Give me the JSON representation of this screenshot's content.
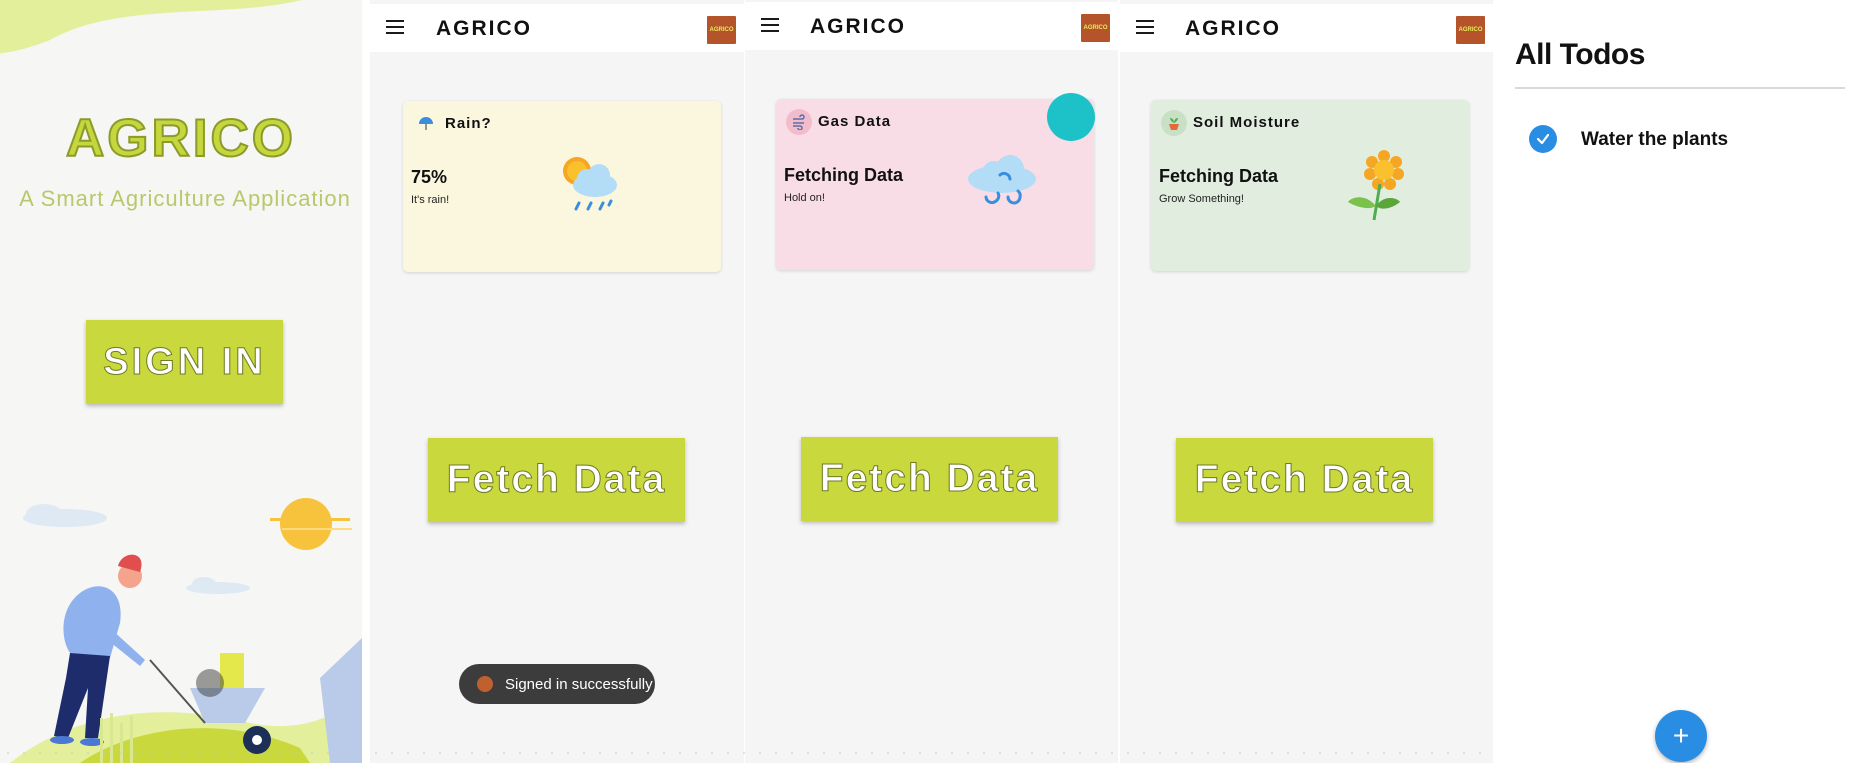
{
  "splash": {
    "brand": "AGRICO",
    "tagline": "A Smart Agriculture Application",
    "signin_label": "SIGN IN"
  },
  "appbar": {
    "title": "AGRICO",
    "logo_text": "AGRICO"
  },
  "rain_screen": {
    "card_label": "Rain?",
    "value": "75%",
    "subtitle": "It's rain!",
    "icon": "umbrella-icon",
    "art": "sun-cloud-rain-icon",
    "card_color": "#fbf7de",
    "fetch_label": "Fetch Data"
  },
  "gas_screen": {
    "card_label": "Gas Data",
    "value": "Fetching Data",
    "subtitle": "Hold on!",
    "icon": "wind-icon",
    "art": "wind-cloud-icon",
    "card_color": "#f9dde6",
    "fetch_label": "Fetch Data"
  },
  "soil_screen": {
    "card_label": "Soil Moisture",
    "value": "Fetching Data",
    "subtitle": "Grow Something!",
    "icon": "plant-pot-icon",
    "art": "sunflower-icon",
    "card_color": "#e1eedf",
    "fetch_label": "Fetch Data"
  },
  "toast": {
    "text": "Signed in successfully"
  },
  "todos": {
    "title": "All Todos",
    "items": [
      {
        "text": "Water the plants",
        "done": true
      }
    ],
    "add_label": "+"
  },
  "colors": {
    "accent": "#c9d83c",
    "fab_blue": "#2a8de4",
    "fab_teal": "#1cc2c8",
    "logo": "#b5542a"
  }
}
